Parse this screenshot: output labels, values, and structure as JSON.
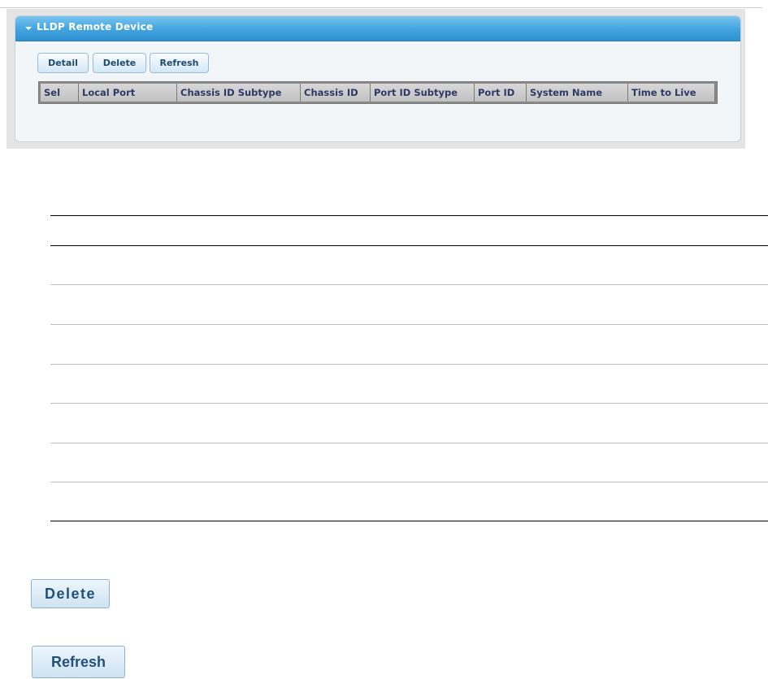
{
  "panel": {
    "title": "LLDP Remote Device"
  },
  "toolbar": {
    "detail_label": "Detail",
    "delete_label": "Delete",
    "refresh_label": "Refresh"
  },
  "table": {
    "columns": [
      "Sel",
      "Local Port",
      "Chassis ID Subtype",
      "Chassis ID",
      "Port ID Subtype",
      "Port ID",
      "System Name",
      "Time to Live"
    ],
    "rows": []
  },
  "buttons": {
    "delete_label": "Delete",
    "refresh_label": "Refresh"
  }
}
